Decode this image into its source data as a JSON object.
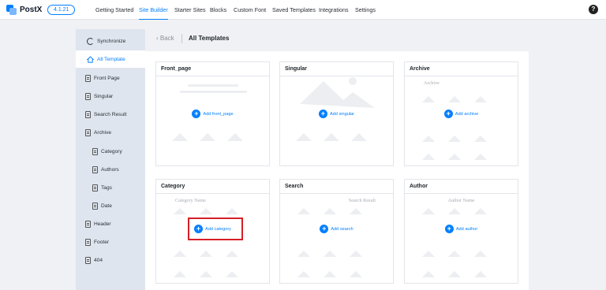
{
  "app": {
    "name": "PostX",
    "version": "4.1.21"
  },
  "nav": {
    "items": [
      "Getting Started",
      "Site Builder",
      "Starter Sites",
      "Blocks",
      "Custom Font",
      "Saved Templates",
      "Integrations",
      "Settings"
    ],
    "active": "Site Builder",
    "help_label": "?"
  },
  "sidebar": {
    "items": [
      {
        "label": "Synchronize",
        "icon": "sync-icon"
      },
      {
        "label": "All Template",
        "icon": "home-icon",
        "active": true
      },
      {
        "label": "Front Page",
        "icon": "front-page-icon"
      },
      {
        "label": "Singular",
        "icon": "document-icon"
      },
      {
        "label": "Search Result",
        "icon": "document-icon"
      },
      {
        "label": "Archive",
        "icon": "document-icon"
      },
      {
        "label": "Category",
        "icon": "document-icon"
      },
      {
        "label": "Authors",
        "icon": "document-icon"
      },
      {
        "label": "Tags",
        "icon": "document-icon"
      },
      {
        "label": "Date",
        "icon": "document-icon"
      },
      {
        "label": "Header",
        "icon": "document-icon"
      },
      {
        "label": "Footer",
        "icon": "document-icon"
      },
      {
        "label": "404",
        "icon": "document-icon"
      }
    ]
  },
  "header": {
    "back_label": "‹ Back",
    "title": "All Templates"
  },
  "cards": [
    {
      "title": "Front_page",
      "preview_label": "",
      "add_label": "Add front_page"
    },
    {
      "title": "Singular",
      "preview_label": "",
      "add_label": "Add singular"
    },
    {
      "title": "Archive",
      "preview_label": "Archive",
      "add_label": "Add archive"
    },
    {
      "title": "Category",
      "preview_label": "Category Name",
      "add_label": "Add category",
      "highlighted": true
    },
    {
      "title": "Search",
      "preview_label": "Search Result",
      "add_label": "Add search"
    },
    {
      "title": "Author",
      "preview_label": "Author Name",
      "add_label": "Add author"
    }
  ],
  "colors": {
    "accent": "#037fff",
    "highlight": "#d61f26",
    "sidebar_bg": "#dfe5ee",
    "page_bg": "#f0f1f4"
  }
}
